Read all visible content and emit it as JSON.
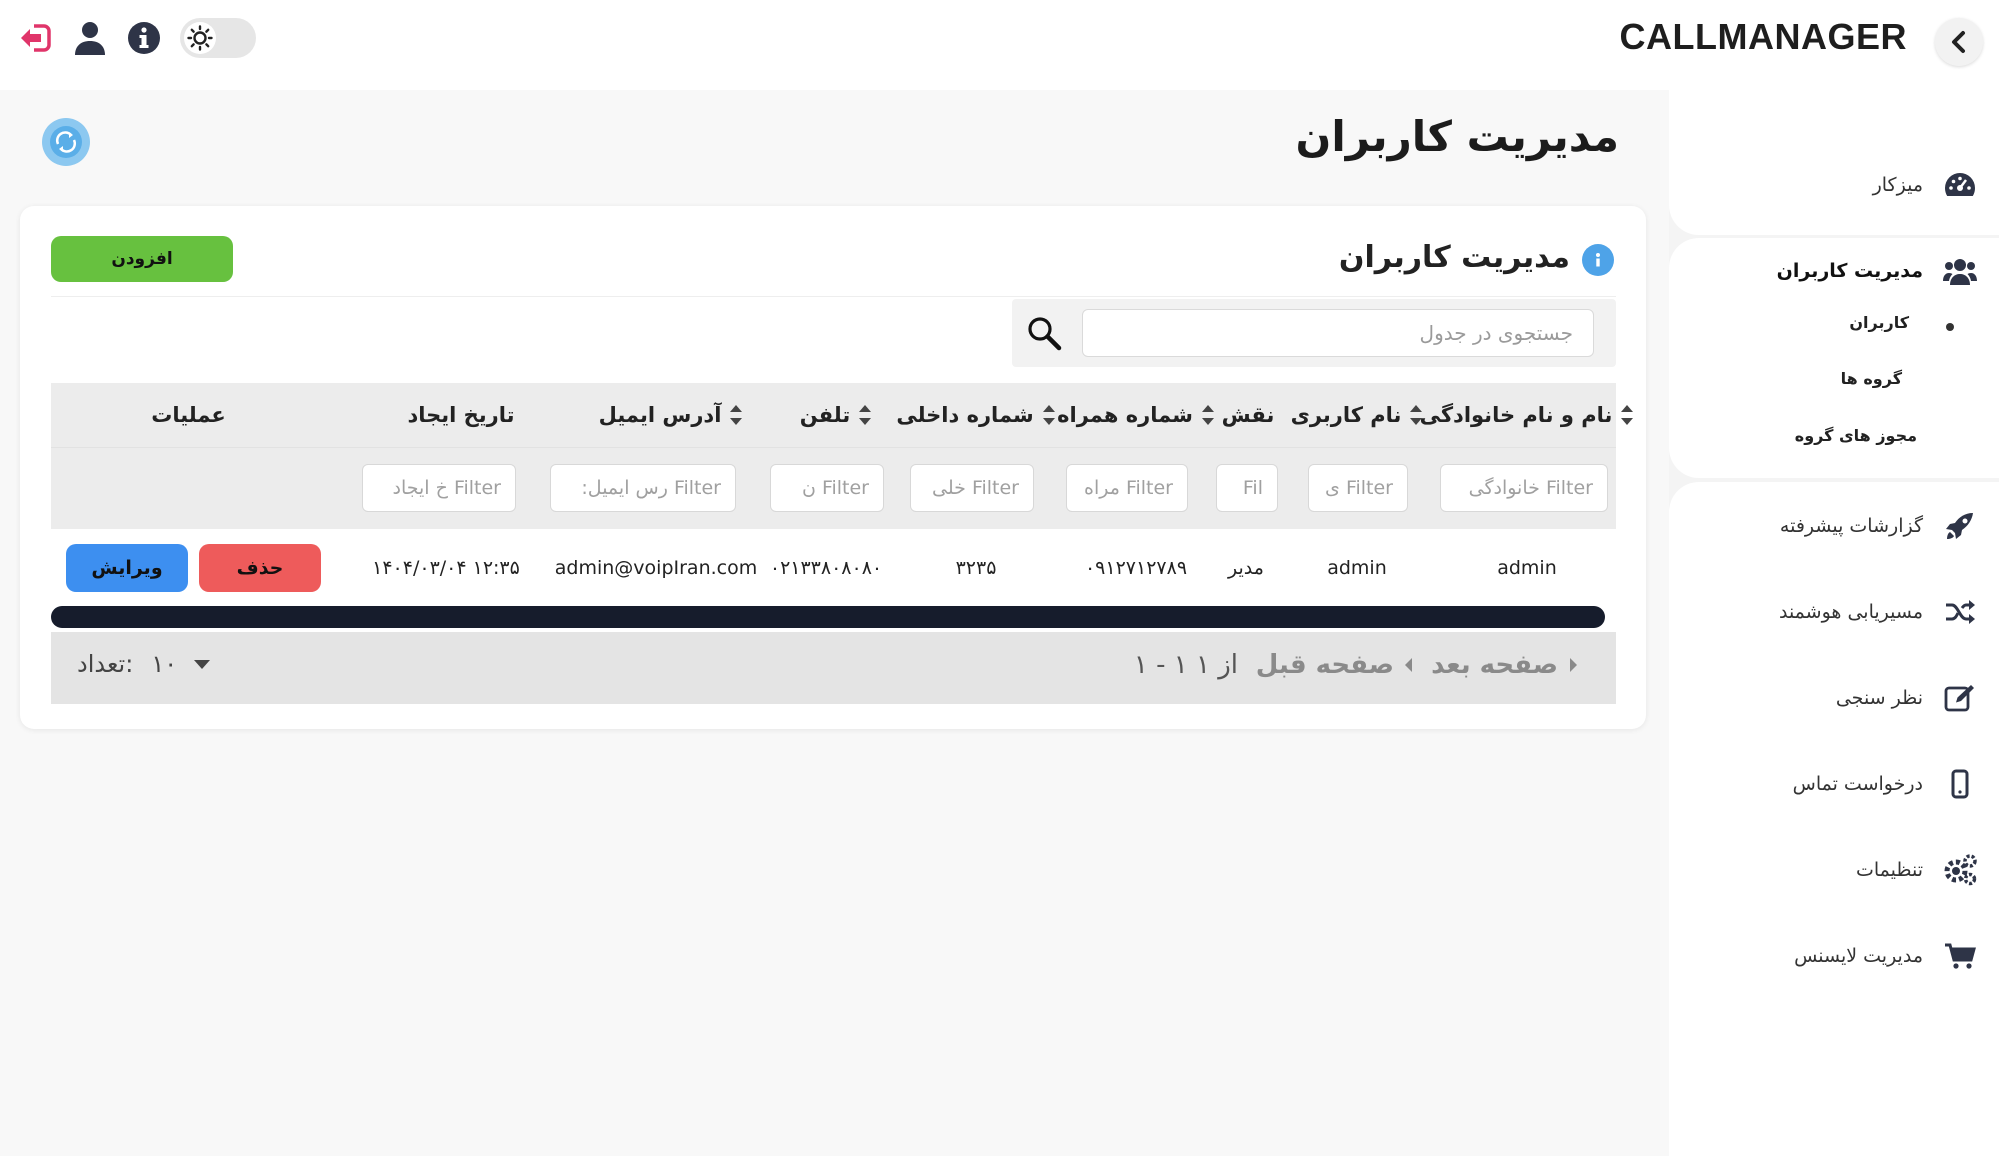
{
  "header": {
    "brand": "CALLMANAGER",
    "icons": [
      "logout-icon",
      "user-icon",
      "info-icon",
      "theme-toggle"
    ]
  },
  "sidebar": {
    "items": [
      {
        "label": "میزکار",
        "icon": "dashboard-icon"
      },
      {
        "label": "مدیریت کاربران",
        "icon": "users-icon",
        "active": true,
        "children": [
          {
            "label": "کاربران",
            "active": true
          },
          {
            "label": "گروه ها"
          },
          {
            "label": "مجوز های گروه"
          }
        ]
      },
      {
        "label": "گزارشات پیشرفته",
        "icon": "rocket-icon"
      },
      {
        "label": "مسیریابی هوشمند",
        "icon": "shuffle-icon"
      },
      {
        "label": "نظر سنجی",
        "icon": "edit-icon"
      },
      {
        "label": "درخواست تماس",
        "icon": "mobile-icon"
      },
      {
        "label": "تنظیمات",
        "icon": "gears-icon"
      },
      {
        "label": "مدیریت لایسنس",
        "icon": "cart-icon"
      }
    ]
  },
  "page": {
    "title": "مدیریت کاربران"
  },
  "card": {
    "title": "مدیریت کاربران",
    "add_label": "افزودن",
    "search_placeholder": "جستجوی در جدول"
  },
  "table": {
    "headers": {
      "full_name": "نام و نام خانوادگی",
      "username": "نام کاربری",
      "role": "نقش",
      "mobile": "شماره همراه",
      "extension": "شماره داخلی",
      "phone": "تلفن",
      "email": "آدرس ایمیل",
      "created": "تاریخ ایجاد",
      "actions": "عملیات"
    },
    "filters": {
      "full_name": "Filter خانوادگی",
      "username": "Filter ی",
      "role": "Fil",
      "mobile": "Filter مراه",
      "extension": "Filter خلی",
      "phone": "Filter ن",
      "email": "Filter رس ایمیل:",
      "created": "Filter خ ایجاد"
    },
    "rows": [
      {
        "full_name": "admin",
        "username": "admin",
        "role": "مدیر",
        "mobile": "۰۹۱۲۷۱۲۷۸۹",
        "extension": "۳۲۳۵",
        "phone": "۰۲۱۳۳۸۰۸۰۸۰",
        "email": "admin@voipIran.com",
        "created": "۱۴۰۴/۰۳/۰۴ ۱۲:۳۵",
        "delete_label": "حذف",
        "edit_label": "ویرایش"
      }
    ]
  },
  "pager": {
    "next_label": "صفحه بعد",
    "prev_label": "صفحه قبل",
    "range": "از ۱ ۱ - ۱",
    "count_label": "تعداد:",
    "page_size": "۱۰"
  },
  "colors": {
    "add": "#67c13f",
    "delete": "#ee5b5b",
    "edit": "#3d8ff0",
    "info": "#4ea3e8",
    "logout": "#e0356a"
  }
}
